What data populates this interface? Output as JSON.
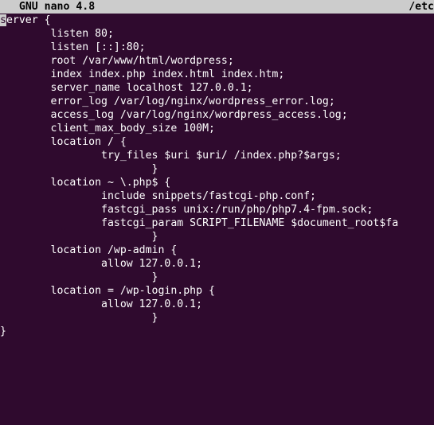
{
  "titlebar": {
    "app": "  GNU nano 4.8",
    "file": "/etc"
  },
  "cursor_char": "s",
  "lines": [
    "erver {",
    "        listen 80;",
    "        listen [::]:80;",
    "        root /var/www/html/wordpress;",
    "        index index.php index.html index.htm;",
    "        server_name localhost 127.0.0.1;",
    "        error_log /var/log/nginx/wordpress_error.log;",
    "        access_log /var/log/nginx/wordpress_access.log;",
    "        client_max_body_size 100M;",
    "",
    "        location / {",
    "                try_files $uri $uri/ /index.php?$args;",
    "                        }",
    "",
    "        location ~ \\.php$ {",
    "                include snippets/fastcgi-php.conf;",
    "                fastcgi_pass unix:/run/php/php7.4-fpm.sock;",
    "                fastcgi_param SCRIPT_FILENAME $document_root$fa",
    "                        }",
    "",
    "        location /wp-admin {",
    "                allow 127.0.0.1;",
    "                        }",
    "",
    "        location = /wp-login.php {",
    "                allow 127.0.0.1;",
    "                        }",
    "",
    "}"
  ]
}
